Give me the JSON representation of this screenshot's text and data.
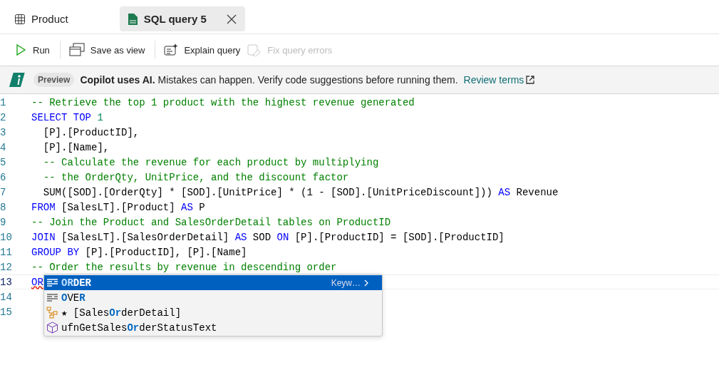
{
  "tabs": [
    {
      "label": "Product",
      "kind": "table",
      "selected": false,
      "closable": false
    },
    {
      "label": "SQL query 5",
      "kind": "sql",
      "selected": true,
      "closable": true
    }
  ],
  "toolbar": [
    {
      "label": "Run",
      "kind": "run",
      "disabled": false
    },
    {
      "label": "Save as view",
      "kind": "view",
      "disabled": false
    },
    {
      "label": "Explain query",
      "kind": "explain",
      "disabled": false
    },
    {
      "label": "Fix query errors",
      "kind": "fix",
      "disabled": true
    }
  ],
  "banner": {
    "badge": "Preview",
    "message": "**Copilot uses AI.** Mistakes can happen. Verify code suggestions before running them.",
    "link": "Review terms"
  },
  "editor": {
    "lines": [
      {
        "number": "1",
        "current": false,
        "tokens": [
          {
            "kind": "comment",
            "text": "-- Retrieve the top 1 product with the highest revenue generated"
          }
        ]
      },
      {
        "number": "2",
        "current": false,
        "tokens": [
          {
            "kind": "keyword",
            "text": "SELECT TOP "
          },
          {
            "kind": "number",
            "text": "1"
          }
        ]
      },
      {
        "number": "3",
        "current": false,
        "tokens": [
          {
            "kind": "plain",
            "text": "  [P].[ProductID],"
          }
        ]
      },
      {
        "number": "4",
        "current": false,
        "tokens": [
          {
            "kind": "plain",
            "text": "  [P].[Name],"
          }
        ]
      },
      {
        "number": "5",
        "current": false,
        "tokens": [
          {
            "kind": "comment",
            "text": "  -- Calculate the revenue for each product by multiplying"
          }
        ]
      },
      {
        "number": "6",
        "current": false,
        "tokens": [
          {
            "kind": "comment",
            "text": "  -- the OrderQty, UnitPrice, and the discount factor"
          }
        ]
      },
      {
        "number": "7",
        "current": false,
        "tokens": [
          {
            "kind": "plain",
            "text": "  SUM([SOD].[OrderQty] * [SOD].[UnitPrice] * (1 - [SOD].[UnitPriceDiscount])) "
          },
          {
            "kind": "keyword",
            "text": "AS"
          },
          {
            "kind": "plain",
            "text": " Revenue"
          }
        ]
      },
      {
        "number": "8",
        "current": false,
        "tokens": [
          {
            "kind": "keyword",
            "text": "FROM"
          },
          {
            "kind": "plain",
            "text": " [SalesLT].[Product] "
          },
          {
            "kind": "keyword",
            "text": "AS"
          },
          {
            "kind": "plain",
            "text": " P"
          }
        ]
      },
      {
        "number": "9",
        "current": false,
        "tokens": [
          {
            "kind": "comment",
            "text": "-- Join the Product and SalesOrderDetail tables on ProductID"
          }
        ]
      },
      {
        "number": "10",
        "current": false,
        "tokens": [
          {
            "kind": "keyword",
            "text": "JOIN"
          },
          {
            "kind": "plain",
            "text": " [SalesLT].[SalesOrderDetail] "
          },
          {
            "kind": "keyword",
            "text": "AS"
          },
          {
            "kind": "plain",
            "text": " SOD "
          },
          {
            "kind": "keyword",
            "text": "ON"
          },
          {
            "kind": "plain",
            "text": " [P].[ProductID] = [SOD].[ProductID]"
          }
        ]
      },
      {
        "number": "11",
        "current": false,
        "tokens": [
          {
            "kind": "keyword",
            "text": "GROUP BY"
          },
          {
            "kind": "plain",
            "text": " [P].[ProductID], [P].[Name]"
          }
        ]
      },
      {
        "number": "12",
        "current": false,
        "tokens": [
          {
            "kind": "comment",
            "text": "-- Order the results by revenue in descending order"
          }
        ]
      },
      {
        "number": "13",
        "current": true,
        "tokens": [
          {
            "kind": "error",
            "text": "OR"
          }
        ]
      },
      {
        "number": "14",
        "current": false
      },
      {
        "number": "15",
        "current": false
      }
    ],
    "suggestions": [
      {
        "label": "**OR**DER",
        "kind": "keyword",
        "selected": true,
        "detail": "Keyw…"
      },
      {
        "label": "**O**VE**R**",
        "kind": "keyword",
        "selected": false
      },
      {
        "label": "★ [Sales**Or**derDetail]",
        "kind": "table",
        "selected": false
      },
      {
        "label": "ufnGetSales**Or**derStatusText",
        "kind": "function",
        "selected": false
      }
    ]
  }
}
